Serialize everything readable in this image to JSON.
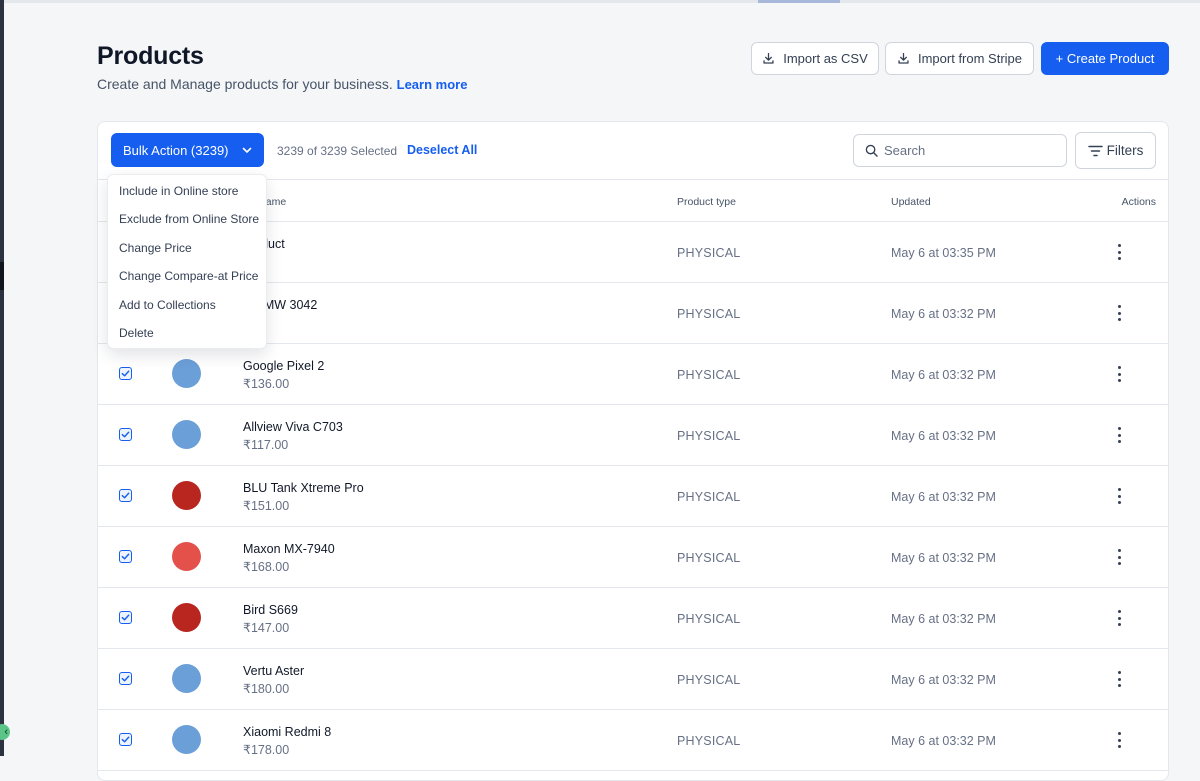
{
  "header": {
    "title": "Products",
    "subtitle": "Create and Manage products for your business.",
    "learn_more": "Learn more",
    "buttons": {
      "import_csv": "Import as CSV",
      "import_stripe": "Import from Stripe",
      "create_product": "+ Create Product"
    }
  },
  "toolbar": {
    "bulk_action_label": "Bulk Action (3239)",
    "selected_text": "3239 of 3239 Selected",
    "deselect_all": "Deselect All",
    "search_placeholder": "Search",
    "filters_label": "Filters"
  },
  "table": {
    "columns": {
      "name": "uct name",
      "type": "Product type",
      "updated": "Updated",
      "actions": "Actions"
    },
    "rows": [
      {
        "name": "product",
        "price": ".00",
        "type": "PHYSICAL",
        "updated": "May 6 at 03:35 PM",
        "thumb_color": "#ffffff",
        "checked": true
      },
      {
        "name": "em MW 3042",
        "price": ".00",
        "type": "PHYSICAL",
        "updated": "May 6 at 03:32 PM",
        "thumb_color": "#ffffff",
        "checked": true
      },
      {
        "name": "Google Pixel 2",
        "price": "₹136.00",
        "type": "PHYSICAL",
        "updated": "May 6 at 03:32 PM",
        "thumb_color": "#6b9fd8",
        "checked": true
      },
      {
        "name": "Allview Viva C703",
        "price": "₹117.00",
        "type": "PHYSICAL",
        "updated": "May 6 at 03:32 PM",
        "thumb_color": "#6b9fd8",
        "checked": true
      },
      {
        "name": "BLU Tank Xtreme Pro",
        "price": "₹151.00",
        "type": "PHYSICAL",
        "updated": "May 6 at 03:32 PM",
        "thumb_color": "#b9261f",
        "checked": true
      },
      {
        "name": "Maxon MX-7940",
        "price": "₹168.00",
        "type": "PHYSICAL",
        "updated": "May 6 at 03:32 PM",
        "thumb_color": "#e4514b",
        "checked": true
      },
      {
        "name": "Bird S669",
        "price": "₹147.00",
        "type": "PHYSICAL",
        "updated": "May 6 at 03:32 PM",
        "thumb_color": "#b9261f",
        "checked": true
      },
      {
        "name": "Vertu Aster",
        "price": "₹180.00",
        "type": "PHYSICAL",
        "updated": "May 6 at 03:32 PM",
        "thumb_color": "#6b9fd8",
        "checked": true
      },
      {
        "name": "Xiaomi Redmi 8",
        "price": "₹178.00",
        "type": "PHYSICAL",
        "updated": "May 6 at 03:32 PM",
        "thumb_color": "#6b9fd8",
        "checked": true
      }
    ]
  },
  "bulk_menu": {
    "items": [
      "Include in Online store",
      "Exclude from Online Store",
      "Change Price",
      "Change Compare-at Price",
      "Add to Collections",
      "Delete"
    ]
  },
  "colors": {
    "primary": "#155eef",
    "page_bg": "#f4f6f8",
    "border": "#e4e7ec"
  }
}
